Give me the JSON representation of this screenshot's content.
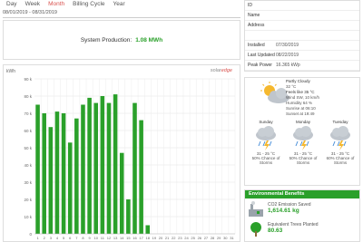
{
  "tabs": [
    "Day",
    "Week",
    "Month",
    "Billing Cycle",
    "Year"
  ],
  "active_tab": "Month",
  "date_range": "08/01/2019 - 08/31/2019",
  "production": {
    "label": "System Production:",
    "value": "1.08 MWh"
  },
  "logo": {
    "prefix": "solar",
    "suffix": "edge"
  },
  "chart_data": {
    "type": "bar",
    "ylabel": "kWh",
    "ylim": [
      0,
      90
    ],
    "yticks": [
      "0",
      "10 k",
      "20 k",
      "30 k",
      "40 k",
      "50 k",
      "60 k",
      "70 k",
      "80 k",
      "90 k"
    ],
    "categories": [
      "1",
      "2",
      "3",
      "4",
      "5",
      "6",
      "7",
      "8",
      "9",
      "10",
      "11",
      "12",
      "13",
      "14",
      "15",
      "16",
      "17",
      "18",
      "19",
      "20",
      "21",
      "22",
      "23",
      "24",
      "25",
      "26",
      "27",
      "28",
      "29",
      "30",
      "31"
    ],
    "values": [
      75,
      70,
      62,
      71,
      70,
      53,
      67,
      75,
      79,
      76,
      80,
      76,
      81,
      47,
      20,
      76,
      66,
      5,
      0,
      0,
      0,
      0,
      0,
      0,
      0,
      0,
      0,
      0,
      0,
      0,
      0
    ],
    "color": "#2aa02a",
    "grid": true
  },
  "info": [
    {
      "k": "ID",
      "v": ""
    },
    {
      "k": "Name",
      "v": ""
    },
    {
      "k": "Address",
      "v": ""
    },
    {
      "k": "",
      "v": ""
    },
    {
      "k": "Installed",
      "v": "07/30/2019"
    },
    {
      "k": "Last Updated",
      "v": "08/22/2019"
    },
    {
      "k": "Peak Power",
      "v": "16.365 kWp"
    }
  ],
  "weather_now": {
    "condition": "Partly Cloudy",
    "temp": "32 °C",
    "feels": "Feels like 35 °C",
    "wind": "Wind SW, 10 km/h",
    "humidity": "Humidity 64 %",
    "sunrise": "Sunrise at 06:10",
    "sunset": "Sunset at 19:49"
  },
  "forecast": [
    {
      "day": "Sunday",
      "temp": "31 - 25 °C",
      "chance": "50% Chance of Storms"
    },
    {
      "day": "Monday",
      "temp": "31 - 25 °C",
      "chance": "50% Chance of Storms"
    },
    {
      "day": "Tuesday",
      "temp": "31 - 25 °C",
      "chance": "60% Chance of Storms"
    }
  ],
  "env": {
    "title": "Environmental Benefits",
    "items": [
      {
        "label": "CO2 Emission Saved",
        "value": "1,614.61 kg",
        "icon": "factory-icon"
      },
      {
        "label": "Equivalent Trees Planted",
        "value": "80.63",
        "icon": "tree-icon"
      }
    ]
  },
  "colors": {
    "accent": "#2aa02a",
    "active_tab": "#d9534f"
  }
}
